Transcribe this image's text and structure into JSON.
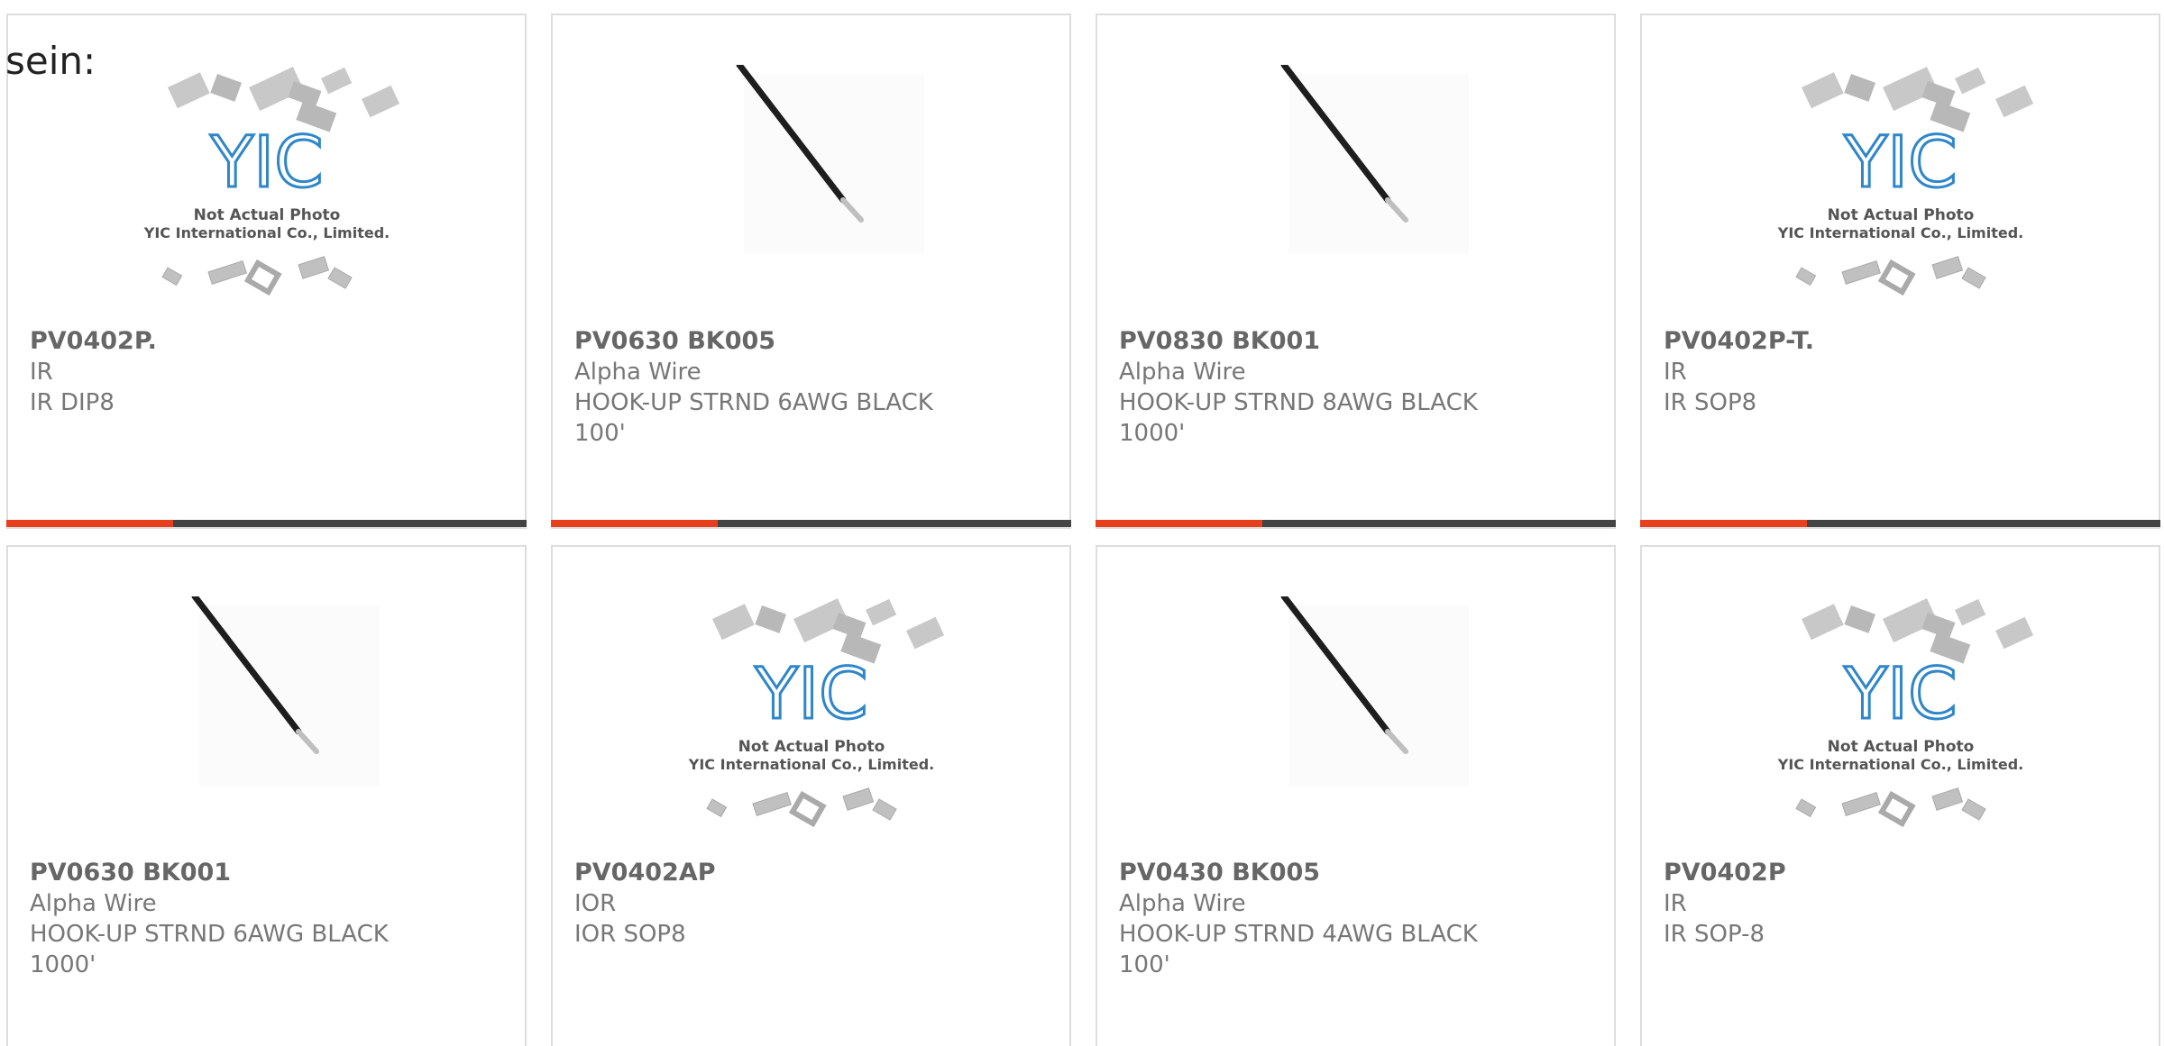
{
  "intro_text": "sein:",
  "colors": {
    "accent": "#e8401c",
    "bar": "#444444",
    "text_pn": "#666666",
    "text_meta": "#777777"
  },
  "products": [
    {
      "part_number": "PV0402P.",
      "manufacturer": "IR",
      "description": "IR DIP8",
      "image": "yic-not-actual-photo",
      "bar_accent_fraction": 0.32
    },
    {
      "part_number": "PV0630 BK005",
      "manufacturer": "Alpha Wire",
      "description": "HOOK-UP STRND 6AWG BLACK 100'",
      "image": "black-wire",
      "bar_accent_fraction": 0.32
    },
    {
      "part_number": "PV0830 BK001",
      "manufacturer": "Alpha Wire",
      "description": "HOOK-UP STRND 8AWG BLACK 1000'",
      "image": "black-wire",
      "bar_accent_fraction": 0.32
    },
    {
      "part_number": "PV0402P-T.",
      "manufacturer": "IR",
      "description": "IR SOP8",
      "image": "yic-not-actual-photo",
      "bar_accent_fraction": 0.32
    },
    {
      "part_number": "PV0630 BK001",
      "manufacturer": "Alpha Wire",
      "description": "HOOK-UP STRND 6AWG BLACK 1000'",
      "image": "black-wire",
      "bar_accent_fraction": null
    },
    {
      "part_number": "PV0402AP",
      "manufacturer": "IOR",
      "description": "IOR SOP8",
      "image": "yic-not-actual-photo",
      "bar_accent_fraction": null
    },
    {
      "part_number": "PV0430 BK005",
      "manufacturer": "Alpha Wire",
      "description": "HOOK-UP STRND 4AWG BLACK 100'",
      "image": "black-wire",
      "bar_accent_fraction": null
    },
    {
      "part_number": "PV0402P",
      "manufacturer": "IR",
      "description": "IR SOP-8",
      "image": "yic-not-actual-photo",
      "bar_accent_fraction": null
    }
  ],
  "placeholder_image": {
    "caption_line1": "Not Actual Photo",
    "caption_line2": "YIC International Co., Limited.",
    "logo_text": "YIC"
  }
}
